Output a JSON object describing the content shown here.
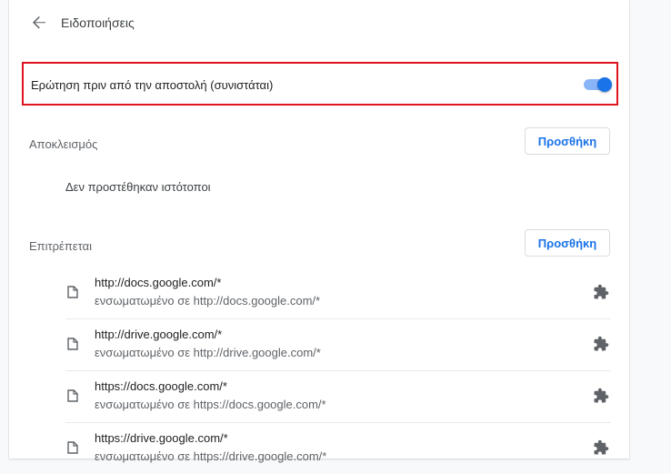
{
  "header": {
    "title": "Ειδοποιήσεις"
  },
  "ask_before_sending": {
    "label": "Ερώτηση πριν από την αποστολή (συνιστάται)",
    "enabled": true
  },
  "colors": {
    "accent": "#1a73e8",
    "highlight_border": "#e0141e"
  },
  "blocked": {
    "title": "Αποκλεισμός",
    "add_label": "Προσθήκη",
    "empty_text": "Δεν προστέθηκαν ιστότοποι"
  },
  "allowed": {
    "title": "Επιτρέπεται",
    "add_label": "Προσθήκη",
    "sites": [
      {
        "url": "http://docs.google.com/*",
        "embedded": "ενσωματωμένο σε http://docs.google.com/*"
      },
      {
        "url": "http://drive.google.com/*",
        "embedded": "ενσωματωμένο σε http://drive.google.com/*"
      },
      {
        "url": "https://docs.google.com/*",
        "embedded": "ενσωματωμένο σε https://docs.google.com/*"
      },
      {
        "url": "https://drive.google.com/*",
        "embedded": "ενσωματωμένο σε https://drive.google.com/*"
      }
    ],
    "site_icon": "file-icon",
    "extension_icon": "extension-icon"
  }
}
